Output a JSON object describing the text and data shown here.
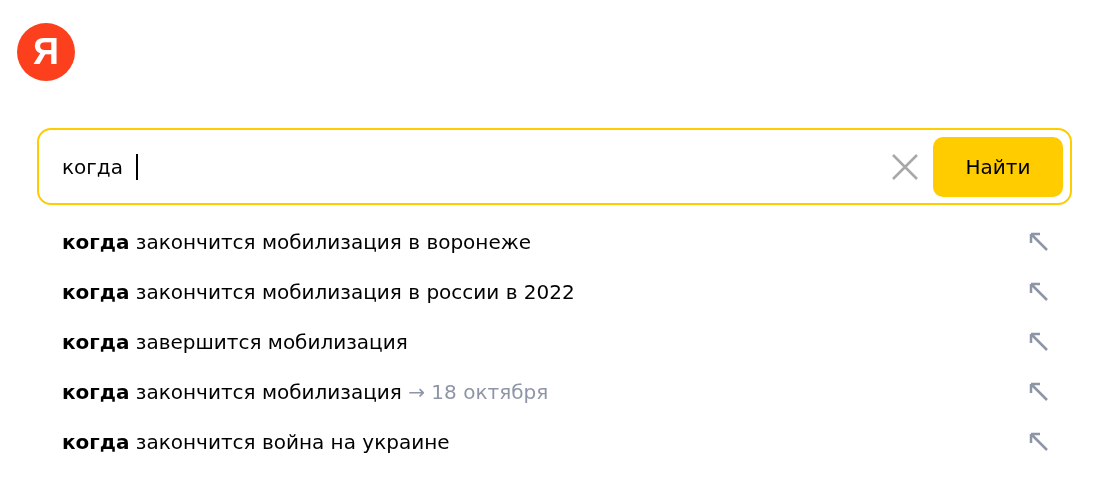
{
  "logo": {
    "letter": "Я"
  },
  "search": {
    "value": "когда",
    "button": "Найти"
  },
  "suggestions": [
    {
      "text": "**когда** закончится мобилизация в воронеже"
    },
    {
      "text": "**когда** закончится мобилизация в россии в 2022"
    },
    {
      "text": "**когда** завершится мобилизация"
    },
    {
      "text": "**когда** закончится мобилизация",
      "hint": "→ 18 октября"
    },
    {
      "text": "**когда** закончится война на украине"
    }
  ]
}
